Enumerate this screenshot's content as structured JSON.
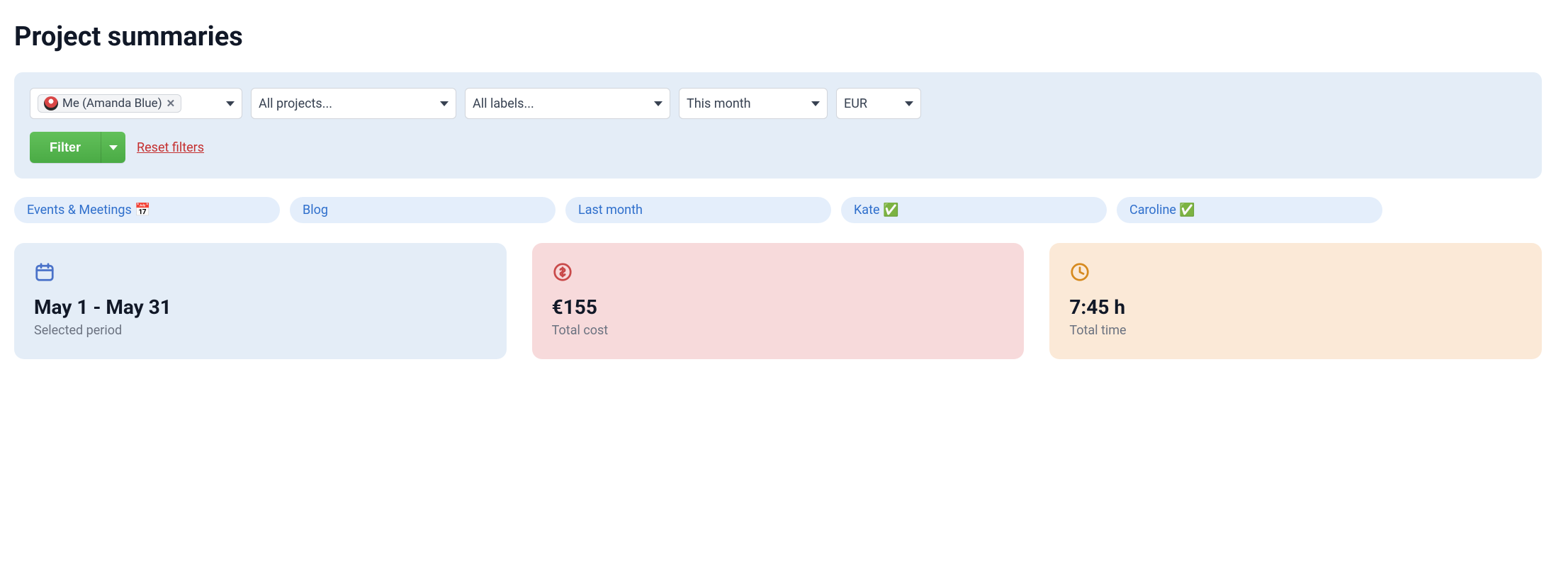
{
  "page": {
    "title": "Project summaries"
  },
  "filters": {
    "user_chip": "Me (Amanda Blue)",
    "projects": "All projects...",
    "labels": "All labels...",
    "period": "This month",
    "currency": "EUR",
    "filter_button": "Filter",
    "reset": "Reset filters"
  },
  "saved_filters": [
    "Events & Meetings 📅",
    "Blog",
    "Last month",
    "Kate ✅",
    "Caroline ✅"
  ],
  "cards": {
    "period": {
      "value": "May 1 - May 31",
      "label": "Selected period"
    },
    "cost": {
      "value": "€155",
      "label": "Total cost"
    },
    "time": {
      "value": "7:45 h",
      "label": "Total time"
    }
  }
}
